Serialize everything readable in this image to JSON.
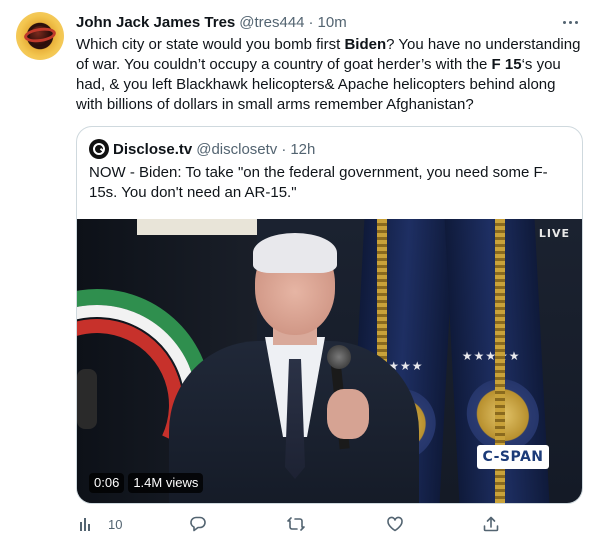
{
  "tweet": {
    "display_name": "John Jack James Tres",
    "handle": "@tres444",
    "separator": "·",
    "time": "10m",
    "text_parts": {
      "p1": "Which city or state would you bomb first ",
      "b1": "Biden",
      "p2": "? You have no understanding of war. You couldn’t occupy a country of goat herder’s with the ",
      "b2": "F 15",
      "p3": "‘s you had, & you left Blackhawk helicopters& Apache helicopters behind along with billions of dollars in small arms remember Afghanistan?"
    }
  },
  "quote": {
    "display_name": "Disclose.tv",
    "handle": "@disclosetv",
    "separator": "·",
    "time": "12h",
    "text": "NOW - Biden: To take \"on the federal government, you need some F-15s. You don't need an AR-15.\"",
    "media": {
      "live_label": "LIVE",
      "network_logo": "C-SPAN",
      "duration": "0:06",
      "views": "1.4M views"
    }
  },
  "actions": {
    "analytics_count": "10",
    "icons": [
      "analytics-icon",
      "reply-icon",
      "retweet-icon",
      "like-icon",
      "share-icon"
    ],
    "icon_color": "#536471"
  },
  "colors": {
    "text": "#0f1419",
    "secondary": "#536471",
    "border": "#cfd9de"
  }
}
